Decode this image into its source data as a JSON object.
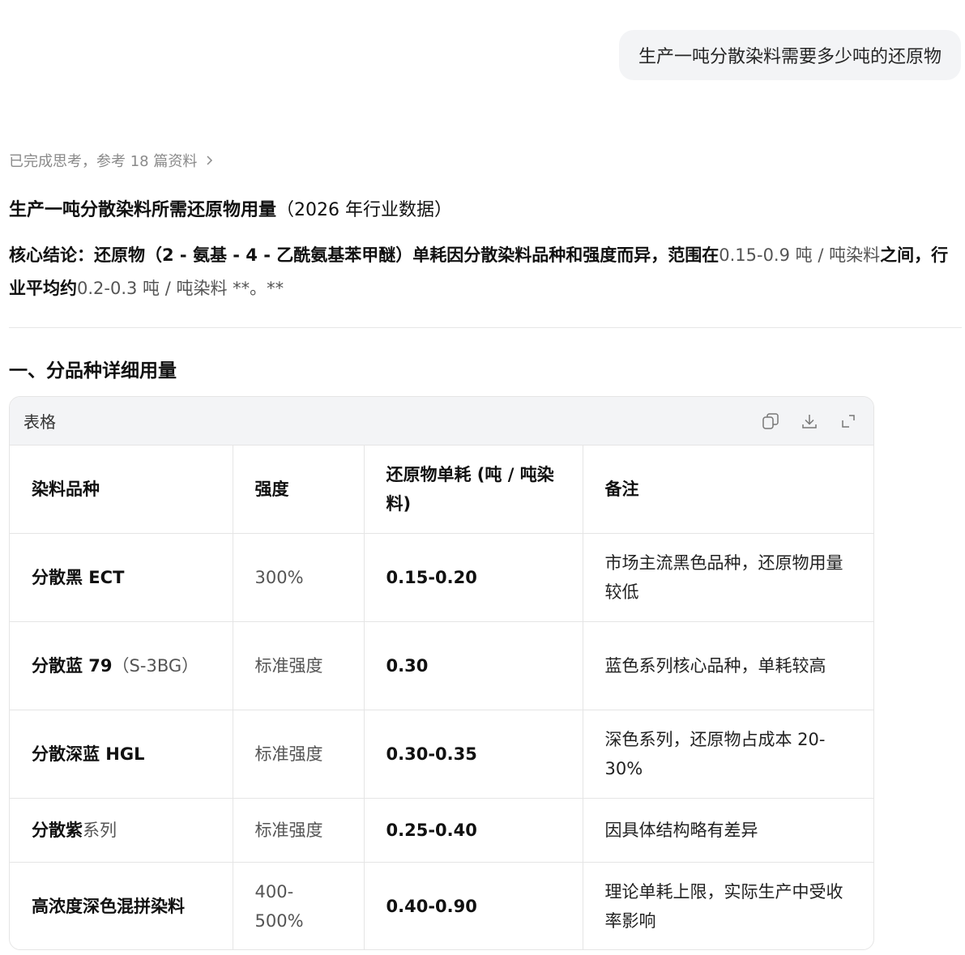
{
  "user_message": "生产一吨分散染料需要多少吨的还原物",
  "thinking_status": "已完成思考，参考 18 篇资料",
  "answer": {
    "title_bold": "生产一吨分散染料所需还原物用量",
    "title_rest": "（2026 年行业数据）",
    "conclusion_bold_1": "核心结论：还原物（2 - 氨基 - 4 - 乙酰氨基苯甲醚）单耗因分散染料品种和强度而异，范围在",
    "conclusion_light_1": "0.15-0.9 吨 / 吨染料",
    "conclusion_bold_2": "之间，行业平均约",
    "conclusion_light_2": "0.2-0.3 吨 / 吨染料 **。**"
  },
  "section_title": "一、分品种详细用量",
  "table": {
    "label": "表格",
    "toolbar_icons": [
      "copy-icon",
      "download-icon",
      "expand-icon"
    ],
    "headers": [
      "染料品种",
      "强度",
      "还原物单耗 (吨 / 吨染料)",
      "备注"
    ],
    "rows": [
      {
        "name": "分散黑 ECT",
        "name_suffix": "",
        "strength": "300%",
        "value": "0.15-0.20",
        "note": "市场主流黑色品种，还原物用量较低"
      },
      {
        "name": "分散蓝 79",
        "name_suffix": "（S-3BG）",
        "strength": "标准强度",
        "value": "0.30",
        "note": "蓝色系列核心品种，单耗较高"
      },
      {
        "name": "分散深蓝 HGL",
        "name_suffix": "",
        "strength": "标准强度",
        "value": "0.30-0.35",
        "note": "深色系列，还原物占成本 20-30%"
      },
      {
        "name": "分散紫",
        "name_suffix": "系列",
        "strength": "标准强度",
        "value": "0.25-0.40",
        "note": "因具体结构略有差异"
      },
      {
        "name": "高浓度深色混拼染料",
        "name_suffix": "",
        "strength": "400-500%",
        "value": "0.40-0.90",
        "note": "理论单耗上限，实际生产中受收率影响"
      }
    ]
  }
}
